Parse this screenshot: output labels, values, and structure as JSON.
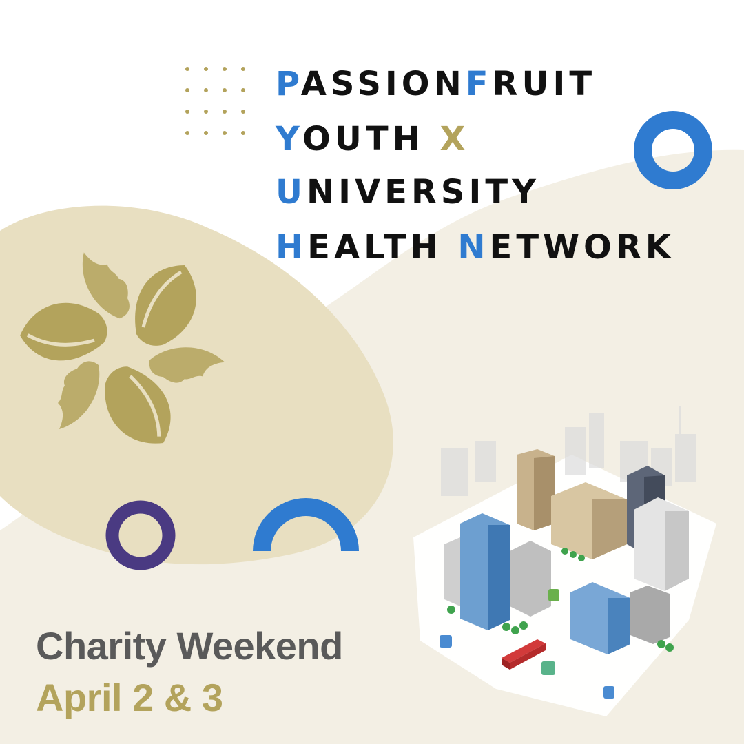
{
  "title": {
    "line1": {
      "initial": "P",
      "rest1": "ASSION",
      "initial2": "F",
      "rest2": "RUIT"
    },
    "line2": {
      "initial": "Y",
      "rest": "OUTH ",
      "x": "X"
    },
    "line3": {
      "initial": "U",
      "rest": "NIVERSITY"
    },
    "line4": {
      "initial": "H",
      "rest1": "EALTH ",
      "initial2": "N",
      "rest2": "ETWORK"
    }
  },
  "event": {
    "name": "Charity Weekend",
    "date": "April 2 & 3"
  },
  "graphics": {
    "logo": "leaf-faces-logo-icon",
    "city": "isometric-city-illustration",
    "dots": "dot-grid-icon"
  },
  "colors": {
    "blue": "#2f7bd0",
    "gold": "#b3a35c",
    "beige_blob": "#e8dfc1",
    "cream_wave": "#f3efe4",
    "purple": "#4a3a82",
    "gray_text": "#5a5a5a",
    "dark_text": "#111111"
  }
}
